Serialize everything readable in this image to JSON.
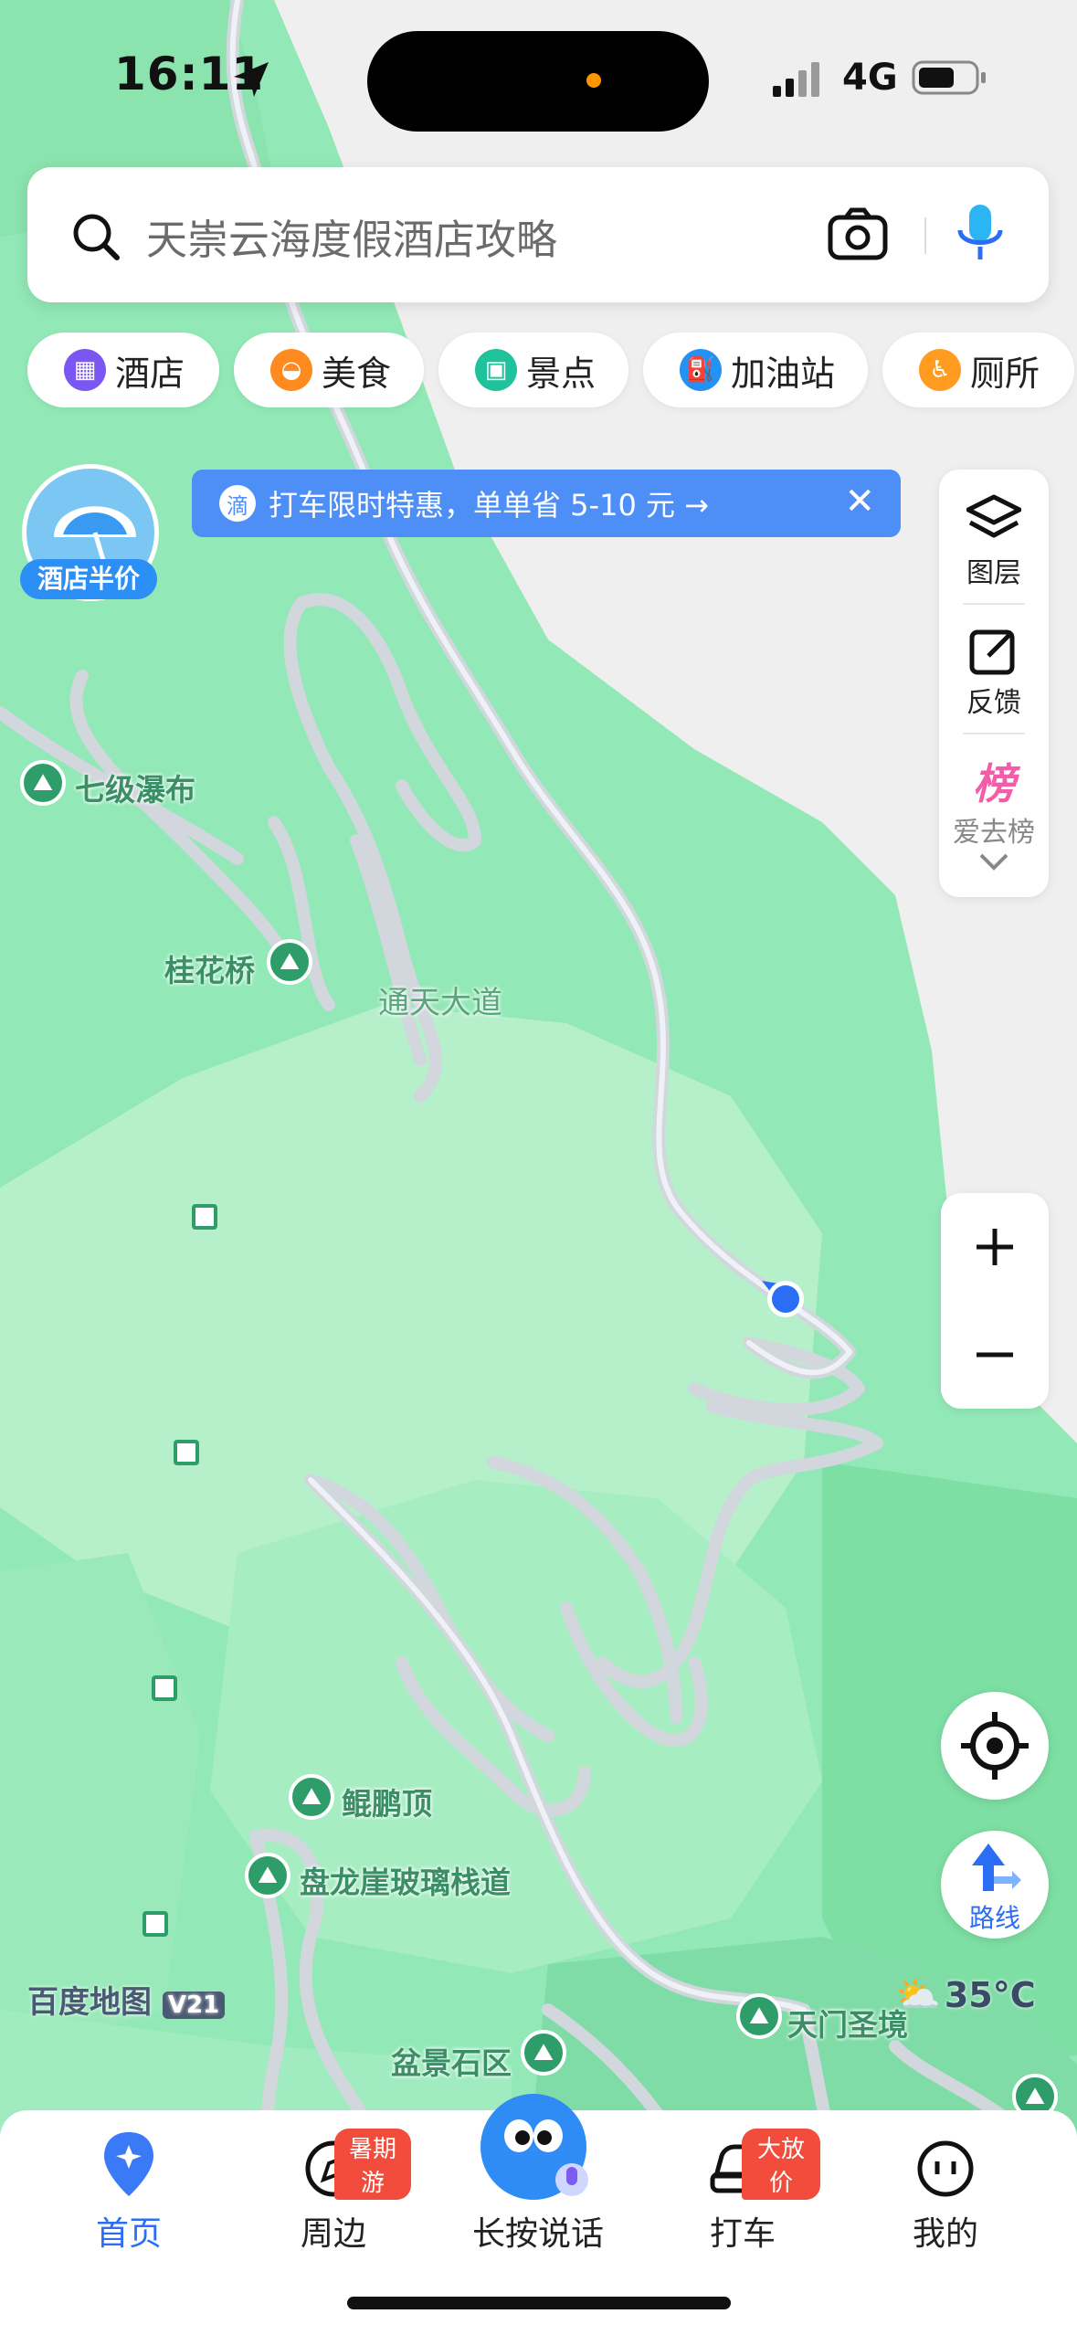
{
  "status_bar": {
    "time": "16:11",
    "network": "4G"
  },
  "search": {
    "placeholder": "天崇云海度假酒店攻略"
  },
  "categories": [
    {
      "label": "酒店",
      "color": "#7b57f2",
      "icon": "hotel-icon"
    },
    {
      "label": "美食",
      "color": "#ff8a1f",
      "icon": "food-icon"
    },
    {
      "label": "景点",
      "color": "#1fc29a",
      "icon": "scenic-icon"
    },
    {
      "label": "加油站",
      "color": "#2492f5",
      "icon": "gas-station-icon"
    },
    {
      "label": "厕所",
      "color": "#ff9b1f",
      "icon": "toilet-icon"
    }
  ],
  "promo": {
    "badge": "酒店半价",
    "banner_text": "打车限时特惠，单单省 5-10 元 →"
  },
  "tools": {
    "layers": "图层",
    "feedback": "反馈",
    "ranking_badge": "榜",
    "ranking": "爱去榜"
  },
  "map": {
    "road_label": "通天大道",
    "pois": {
      "qiji_waterfall": "七级瀑布",
      "guihua_bridge": "桂花桥",
      "kunpeng_peak": "鲲鹏顶",
      "panlong_glass": "盘龙崖玻璃栈道",
      "tianmen": "天门圣境",
      "penjing": "盆景石区"
    },
    "branding": "百度地图",
    "version": "V21",
    "temperature": "35°C"
  },
  "route_button": "路线",
  "nav": {
    "home": "首页",
    "nearby": "周边",
    "nearby_badge": "暑期游",
    "voice": "长按说话",
    "taxi": "打车",
    "taxi_badge": "大放价",
    "mine": "我的"
  },
  "colors": {
    "accent": "#2b6ef5",
    "map_green": "#8fe8b6",
    "map_light": "#b8f2cf"
  }
}
